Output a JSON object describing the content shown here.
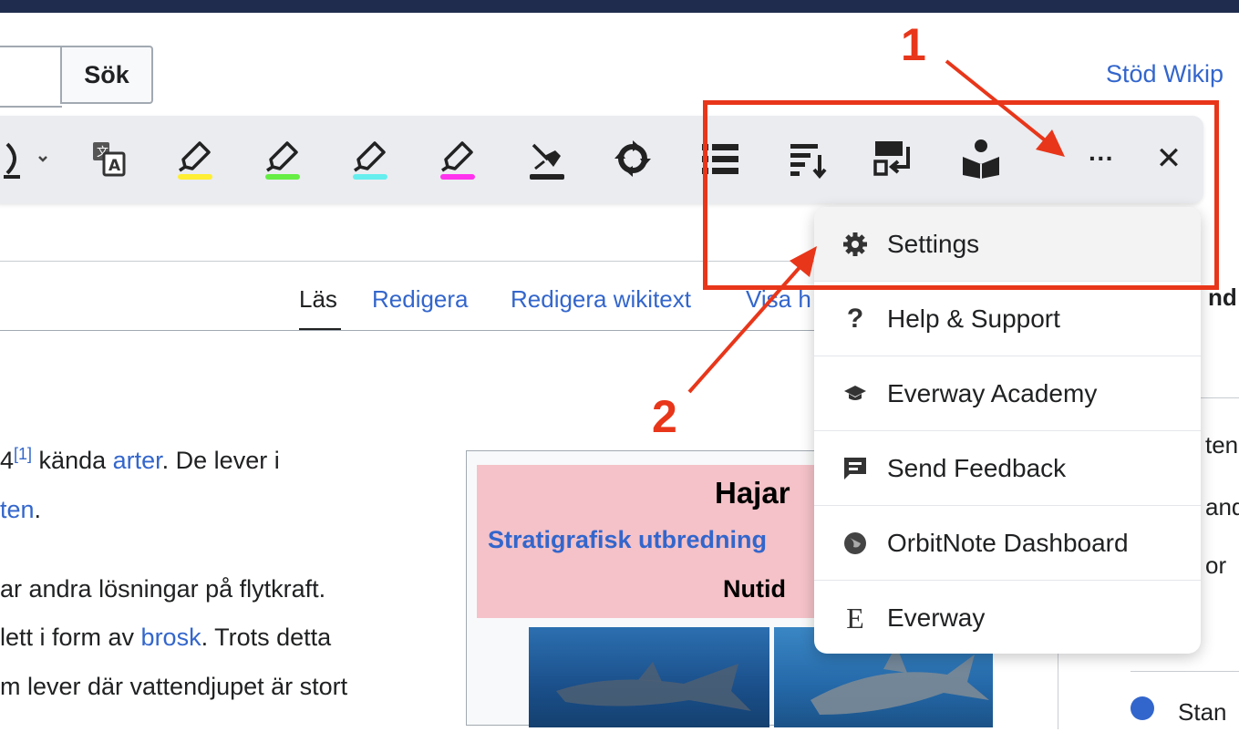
{
  "header": {
    "search_button": "Sök",
    "support_link": "Stöd Wikip"
  },
  "toolbar": {
    "icons": [
      "voice-icon",
      "translate-icon",
      "highlighter-yellow-icon",
      "highlighter-green-icon",
      "highlighter-cyan-icon",
      "highlighter-magenta-icon",
      "clear-highlight-icon",
      "refresh-icon",
      "list-icon",
      "sort-icon",
      "page-flow-icon",
      "reader-icon",
      "more-icon",
      "close-icon"
    ],
    "more_glyph": "···",
    "close_glyph": "✕",
    "colors": {
      "yellow": "#ffee33",
      "green": "#66ee44",
      "cyan": "#66eeee",
      "magenta": "#ff33ee"
    }
  },
  "tabs": [
    {
      "label": "Läs",
      "active": true
    },
    {
      "label": "Redigera"
    },
    {
      "label": "Redigera wikitext"
    },
    {
      "label": "Visa h"
    }
  ],
  "article": {
    "line1": {
      "prefix": "4",
      "sup": "[1]",
      "mid": " kända ",
      "link": "arter",
      "suffix": ". De lever i"
    },
    "line2": {
      "link": "ten",
      "suffix": "."
    },
    "line3": "ar andra lösningar på flytkraft.",
    "line4": {
      "prefix": "lett i form av ",
      "link": "brosk",
      "suffix": ". Trots detta"
    },
    "line5": "m lever där vattendjupet är stort"
  },
  "infobox": {
    "title": "Hajar",
    "subtitle_link": "Stratigrafisk utbredning",
    "era": "Nutid"
  },
  "menu": {
    "items": [
      {
        "label": "Settings",
        "icon": "gear-icon"
      },
      {
        "label": "Help & Support",
        "icon": "question-icon"
      },
      {
        "label": "Everway Academy",
        "icon": "graduation-cap-icon"
      },
      {
        "label": "Send Feedback",
        "icon": "feedback-icon"
      },
      {
        "label": "OrbitNote Dashboard",
        "icon": "globe-icon"
      },
      {
        "label": "Everway",
        "icon": "everway-logo-icon"
      }
    ]
  },
  "right_column": {
    "header": "nd",
    "lines": [
      "ten",
      "and",
      "or"
    ],
    "bottom": "Stan"
  },
  "annotations": {
    "label_1": "1",
    "label_2": "2",
    "color": "#e8361a"
  }
}
